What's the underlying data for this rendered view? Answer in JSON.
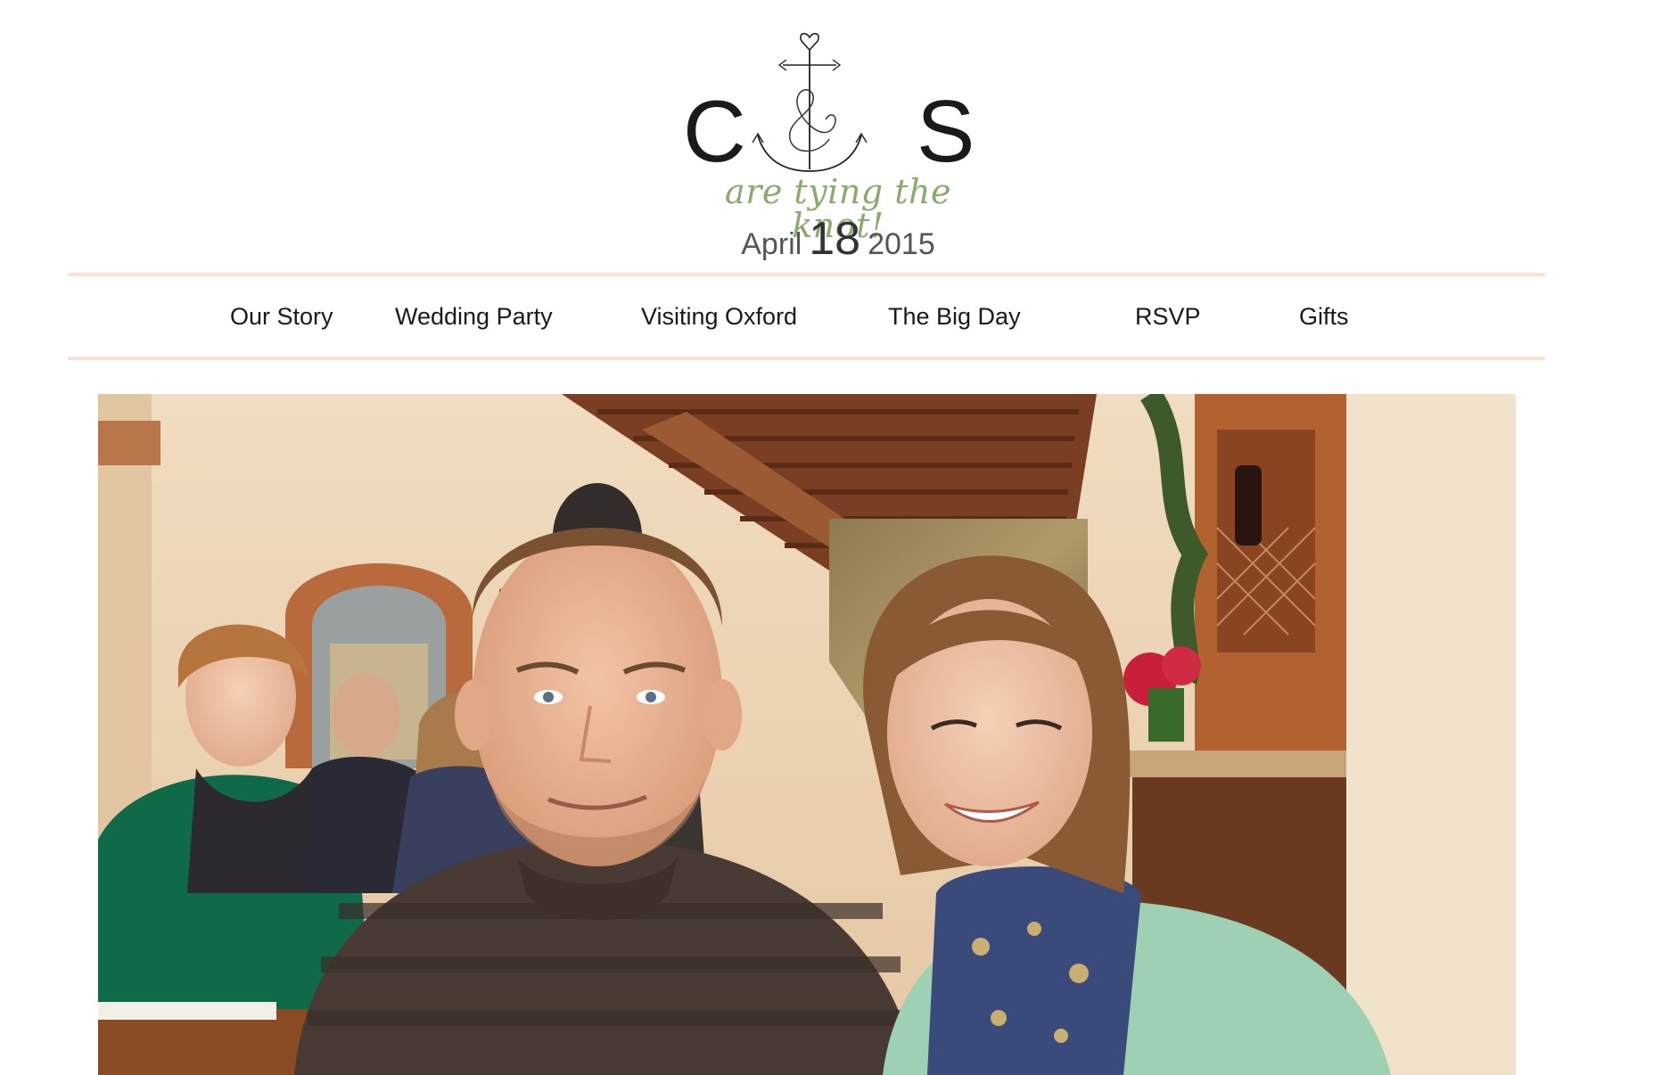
{
  "monogram": {
    "left_initial": "C",
    "right_initial": "S",
    "icon": "anchor-ampersand-icon"
  },
  "tagline": "are tying the knot!",
  "date": {
    "month": "April",
    "day": "18",
    "year": "2015"
  },
  "nav": {
    "items": [
      {
        "label": "Our Story"
      },
      {
        "label": "Wedding Party"
      },
      {
        "label": "Visiting Oxford"
      },
      {
        "label": "The Big Day"
      },
      {
        "label": "RSVP"
      },
      {
        "label": "Gifts"
      }
    ]
  },
  "colors": {
    "accent_rule": "#fbe2d4",
    "tagline_green": "#8aaa6e",
    "text": "#1a1a1a"
  }
}
